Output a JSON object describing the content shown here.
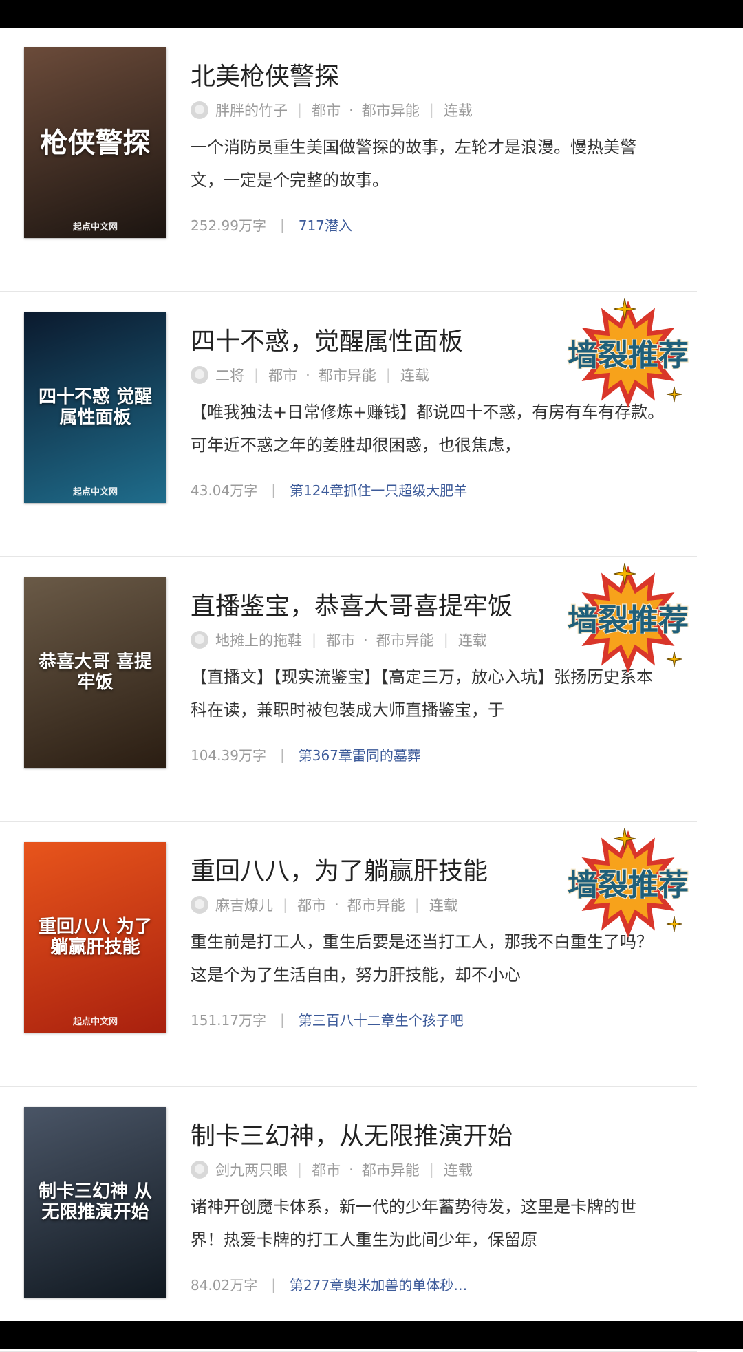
{
  "books": [
    {
      "title": "北美枪侠警探",
      "author": "胖胖的竹子",
      "category": "都市",
      "subcategory": "都市异能",
      "status": "连载",
      "description": "一个消防员重生美国做警探的故事，左轮才是浪漫。慢热美警文，一定是个完整的故事。",
      "word_count": "252.99万字",
      "latest": "717潜入",
      "cover_title": "枪侠警探",
      "cover_publisher": "起点中文网",
      "cover_colors": [
        "#6b4b3a",
        "#1b1410"
      ],
      "badge": false
    },
    {
      "title": "四十不惑，觉醒属性面板",
      "author": "二将",
      "category": "都市",
      "subcategory": "都市异能",
      "status": "连载",
      "description": "【唯我独法+日常修炼+赚钱】都说四十不惑，有房有车有存款。可年近不惑之年的姜胜却很困惑，也很焦虑，",
      "word_count": "43.04万字",
      "latest": "第124章抓住一只超级大肥羊",
      "cover_title": "四十不惑 觉醒属性面板",
      "cover_publisher": "起点中文网",
      "cover_colors": [
        "#0b1a2e",
        "#1f6d8c"
      ],
      "badge": true
    },
    {
      "title": "直播鉴宝，恭喜大哥喜提牢饭",
      "author": "地摊上的拖鞋",
      "category": "都市",
      "subcategory": "都市异能",
      "status": "连载",
      "description": "【直播文】【现实流鉴宝】【高定三万，放心入坑】张扬历史系本科在读，兼职时被包装成大师直播鉴宝，于",
      "word_count": "104.39万字",
      "latest": "第367章雷同的墓葬",
      "cover_title": "恭喜大哥 喜提牢饭",
      "cover_publisher": "",
      "cover_colors": [
        "#6a5a47",
        "#2a1d12"
      ],
      "badge": true
    },
    {
      "title": "重回八八，为了躺赢肝技能",
      "author": "麻吉燎儿",
      "category": "都市",
      "subcategory": "都市异能",
      "status": "连载",
      "description": "重生前是打工人，重生后要是还当打工人，那我不白重生了吗？这是个为了生活自由，努力肝技能，却不小心",
      "word_count": "151.17万字",
      "latest": "第三百八十二章生个孩子吧",
      "cover_title": "重回八八 为了躺赢肝技能",
      "cover_publisher": "起点中文网",
      "cover_colors": [
        "#e8551c",
        "#a8200e"
      ],
      "badge": true
    },
    {
      "title": "制卡三幻神，从无限推演开始",
      "author": "剑九两只眼",
      "category": "都市",
      "subcategory": "都市异能",
      "status": "连载",
      "description": "诸神开创魔卡体系，新一代的少年蓄势待发，这里是卡牌的世界！热爱卡牌的打工人重生为此间少年，保留原",
      "word_count": "84.02万字",
      "latest": "第277章奥米加兽的单体秒…",
      "cover_title": "制卡三幻神 从无限推演开始",
      "cover_publisher": "",
      "cover_colors": [
        "#4a5566",
        "#101820"
      ],
      "badge": false
    }
  ],
  "badge_text": "墙裂推荐",
  "colors": {
    "link": "#3c5a99",
    "meta": "#9a9a9a",
    "badge_burst_outer": "#d9362a",
    "badge_burst_inner": "#f7a21b",
    "badge_text": "#1f5f7a",
    "badge_star": "#f4b400"
  }
}
